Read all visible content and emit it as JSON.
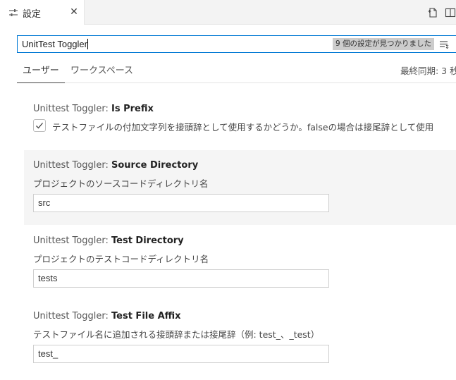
{
  "tab": {
    "label": "設定",
    "close_glyph": "✕",
    "icon": "settings-sliders-icon"
  },
  "editor_actions": [
    "open-settings-json-icon",
    "split-editor-icon"
  ],
  "search": {
    "value": "UnitTest Toggler",
    "result_count": "9 個の設定が見つかりました",
    "filter_icon": "filter-list-icon"
  },
  "scopes": {
    "user": "ユーザー",
    "workspace": "ワークスペース",
    "last_synced": "最終同期: 3 秒"
  },
  "settings": [
    {
      "category": "Unittest Toggler: ",
      "name": "Is Prefix",
      "description": "テストファイルの付加文字列を接頭辞として使用するかどうか。falseの場合は接尾辞として使用",
      "checked": true
    },
    {
      "category": "Unittest Toggler: ",
      "name": "Source Directory",
      "description": "プロジェクトのソースコードディレクトリ名",
      "value": "src"
    },
    {
      "category": "Unittest Toggler: ",
      "name": "Test Directory",
      "description": "プロジェクトのテストコードディレクトリ名",
      "value": "tests"
    },
    {
      "category": "Unittest Toggler: ",
      "name": "Test File Affix",
      "description": "テストファイル名に追加される接頭辞または接尾辞（例: test_、_test）",
      "value": "test_"
    }
  ],
  "colors": {
    "accent": "#0078d4",
    "focused_row": "#f5f5f5"
  }
}
